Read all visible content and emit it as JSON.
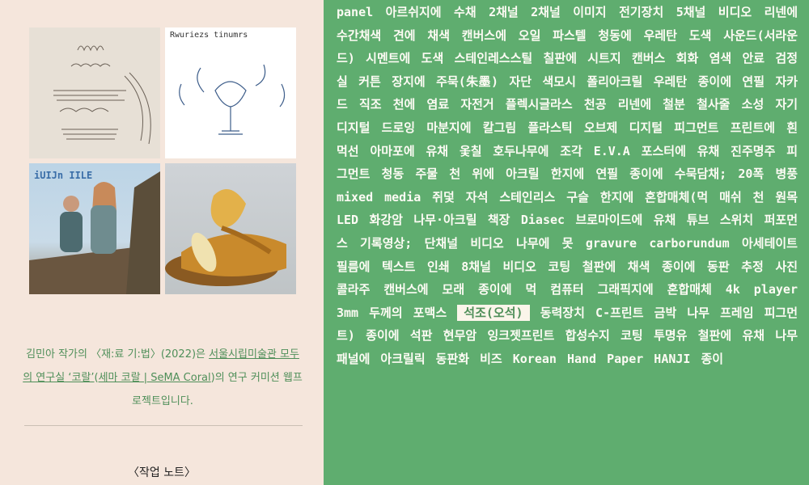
{
  "sidebar": {
    "thumbnails": [
      {
        "name": "thumb-1",
        "caption": ""
      },
      {
        "name": "thumb-2",
        "caption": "Rwuriezs tinumrs"
      },
      {
        "name": "thumb-3",
        "caption": "iUIJn IILE"
      },
      {
        "name": "thumb-4",
        "caption": ""
      }
    ],
    "description": {
      "part1": "김민아 작가의 〈재:료 기:법〉(2022)은 ",
      "link1": "서울시립미술관 모두의 연구실 ‘코랄’",
      "part2": "(",
      "link2": "세마 코랄 | SeMA Coral",
      "part3": ")의 연구 커미션 웹프로젝트입니다."
    },
    "note_label": "〈작업 노트〉"
  },
  "tags": [
    "panel",
    "아르쉬지에 수채",
    "2채널 2채널 이미지",
    "전기장치",
    "5채널 비디오",
    "리넨에 수간채색",
    "견에 채색",
    "캔버스에 오일 파스텔",
    "청동에 우레탄 도색",
    "사운드(서라운드)",
    "시멘트에 도색",
    "스테인레스스틸",
    "칠판에 시트지",
    "캔버스 회화",
    "염색 안료",
    "검정실 커튼",
    "장지에 주묵(朱墨)",
    "자단",
    "색모시",
    "폴리아크릴 우레탄",
    "종이에 연필",
    "자카드 직조 천에 염료",
    "자전거",
    "플렉시글라스 천공",
    "리넨에 철분",
    "철사줄",
    "소성 자기",
    "디지털 드로잉",
    "마분지에 칼그림",
    "플라스틱 오브제",
    "디지털 피그먼트 프린트에 흰 먹선",
    "아마포에 유채",
    "옻칠",
    "호두나무에 조각",
    "E.V.A 포스터에 유채",
    "진주명주",
    "피그먼트",
    "청동 주물",
    "천 위에 아크릴",
    "한지에 연필",
    "종이에 수묵담채; 20폭 병풍",
    "mixed media",
    "쥐덫",
    "자석",
    "스테인리스 구슬",
    "한지에 혼합매체(먹 매쉬 천 원목",
    "LED",
    "화강암",
    "나무·아크릴 책장",
    "Diasec",
    "브로마이드에 유채",
    "튜브",
    "스위치",
    "퍼포먼스 기록영상; 단채널 비디오",
    "나무에 못",
    "gravure carborundum",
    "아세테이트 필름에 텍스트 인쇄",
    "8채널 비디오",
    "코팅",
    "철판에 채색",
    "종이에 동판 추정",
    "사진 콜라주",
    "캔버스에 모래",
    "종이에 먹",
    "컴퓨터 그래픽지에 혼합매체",
    "4k player",
    "3mm 두께의 포맥스",
    "석조(오석)",
    "동력장치",
    "C-프린트",
    "금박 나무 프레임",
    "피그먼트)",
    "종이에 석판",
    "현무암",
    "잉크젯프린트",
    "합성수지 코팅",
    "투명유",
    "철판에 유채",
    "나무패널에 아크릴릭",
    "동판화",
    "비즈",
    "Korean Hand Paper HANJI",
    "종이"
  ],
  "active_tag": "석조(오석)",
  "colors": {
    "accent_green": "#5fad6f",
    "background": "#f5e6dc",
    "link_green": "#4f8f59"
  }
}
